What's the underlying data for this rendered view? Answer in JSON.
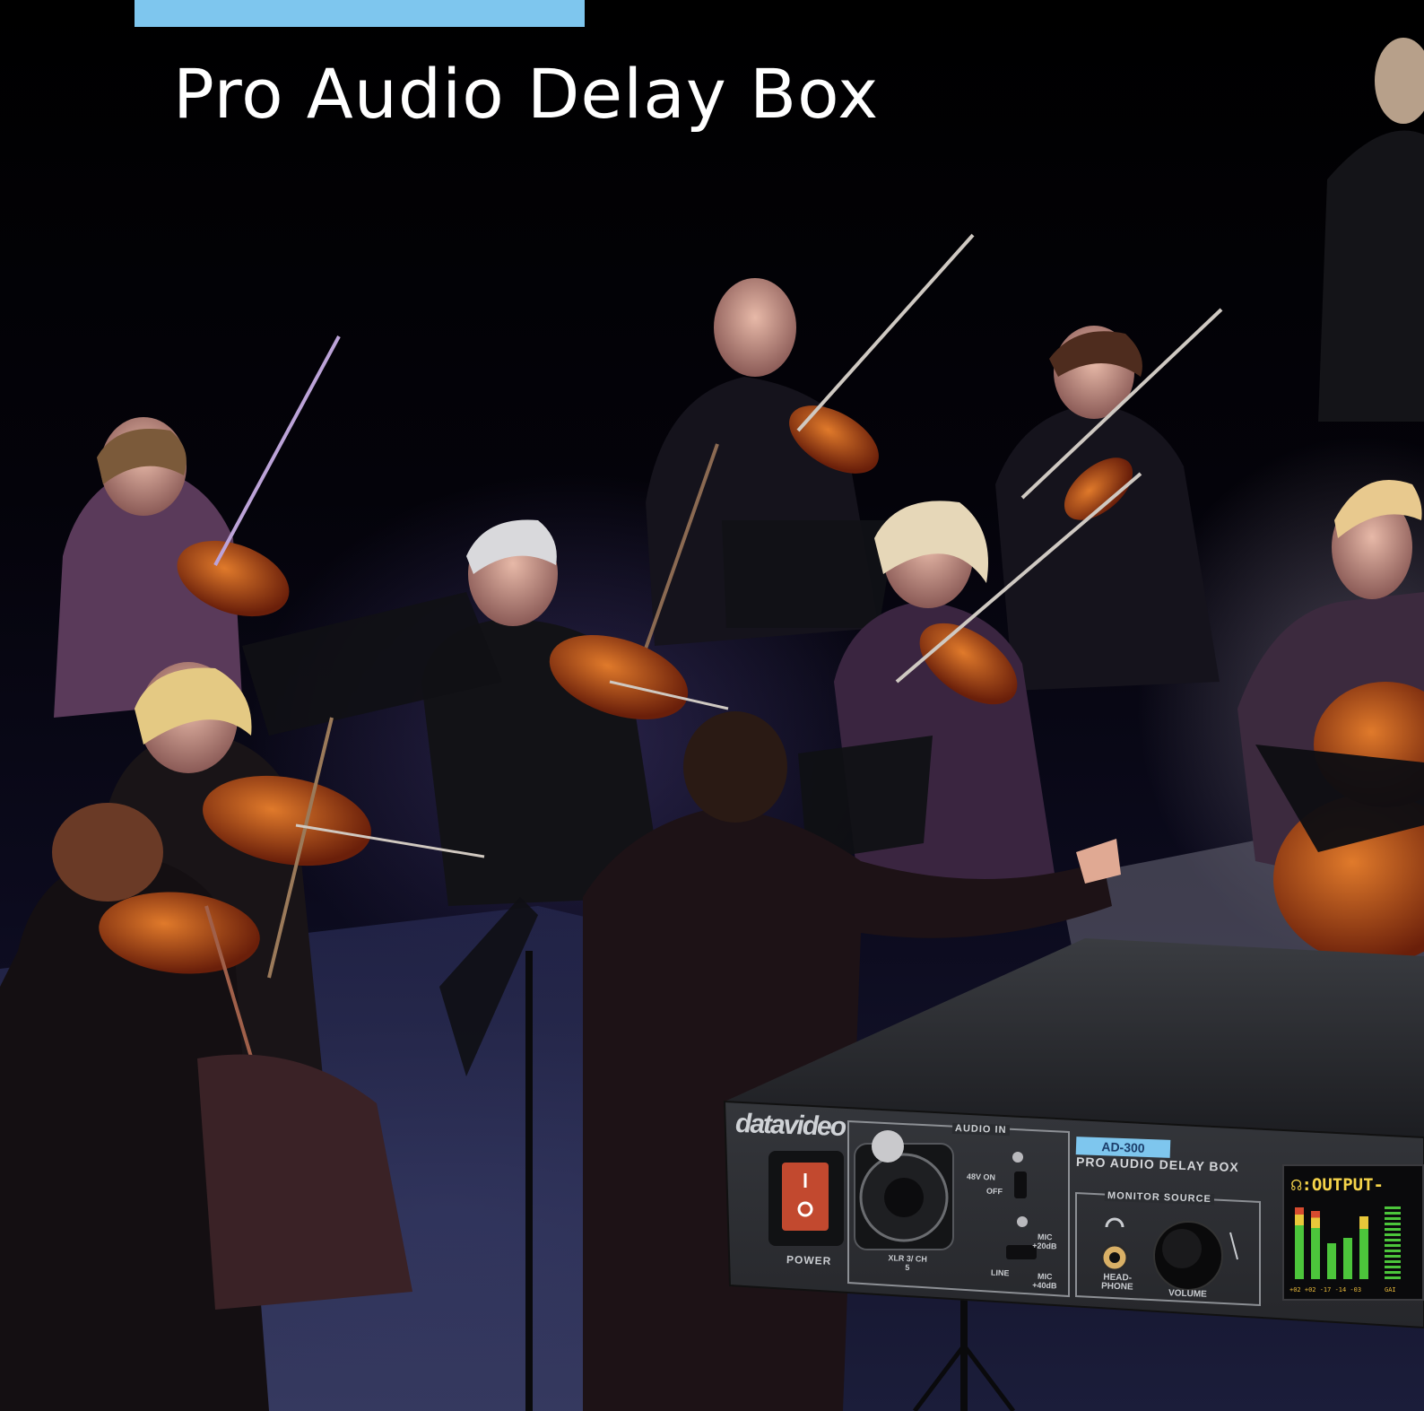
{
  "page": {
    "title": "Pro Audio Delay Box",
    "background_color": "#000000",
    "accent_color": "#7ec6ee"
  },
  "device": {
    "brand": "datavideo",
    "power_label": "POWER",
    "audio_in_label": "AUDIO IN",
    "phantom_on_label": "48V ON",
    "phantom_off_label": "OFF",
    "xlr_label": "XLR 3/ CH 5",
    "mic_20_label": "MIC +20dB",
    "line_label": "LINE",
    "mic_40_label": "MIC +40dB",
    "model": "AD-300",
    "model_description": "PRO AUDIO DELAY BOX",
    "monitor_source_label": "MONITOR SOURCE",
    "headphone_label": "HEAD- PHONE",
    "volume_label": "VOLUME",
    "lcd_title": "☊:OUTPUT-",
    "lcd_scale": "+02 +02 -17 -14 -03",
    "lcd_gain": "GAI"
  }
}
